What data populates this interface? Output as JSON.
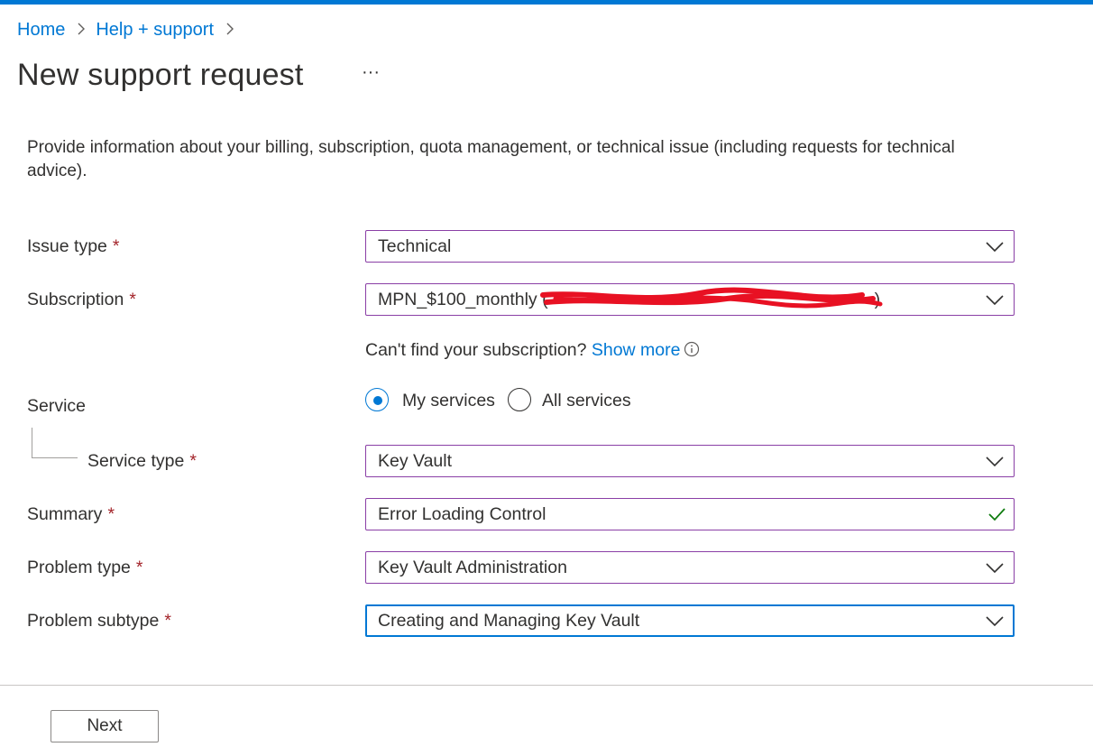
{
  "breadcrumb": {
    "items": [
      "Home",
      "Help + support"
    ]
  },
  "page": {
    "title": "New support request",
    "more_label": "···",
    "intro": "Provide information about your billing, subscription, quota management, or technical issue (including requests for technical advice)."
  },
  "form": {
    "required_mark": "*",
    "issue_type": {
      "label": "Issue type",
      "value": "Technical"
    },
    "subscription": {
      "label": "Subscription",
      "value": "MPN_$100_monthly (",
      "suffix": ")"
    },
    "subscription_hint": {
      "text": "Can't find your subscription?",
      "link": "Show more"
    },
    "service": {
      "label": "Service",
      "options": [
        {
          "label": "My services",
          "checked": true
        },
        {
          "label": "All services",
          "checked": false
        }
      ]
    },
    "service_type": {
      "label": "Service type",
      "value": "Key Vault"
    },
    "summary": {
      "label": "Summary",
      "value": "Error Loading Control"
    },
    "problem_type": {
      "label": "Problem type",
      "value": "Key Vault Administration"
    },
    "problem_subtype": {
      "label": "Problem subtype",
      "value": "Creating and Managing Key Vault"
    }
  },
  "footer": {
    "next_label": "Next"
  },
  "colors": {
    "accent": "#0078d4",
    "field_border": "#8a3fa6",
    "required": "#a4262c",
    "success": "#107c10",
    "redaction": "#e81123"
  },
  "icons": [
    "chevron-right-icon",
    "more-icon",
    "chevron-down-icon",
    "info-icon",
    "checkmark-icon"
  ]
}
